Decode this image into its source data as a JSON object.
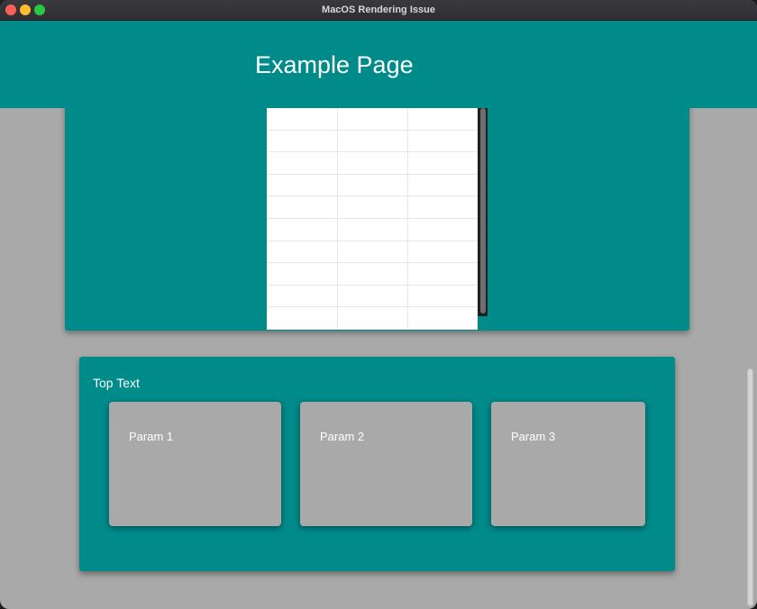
{
  "window": {
    "title": "MacOS Rendering Issue"
  },
  "header": {
    "title": "Example Page"
  },
  "table": {
    "rows": [
      [
        "",
        "",
        ""
      ],
      [
        "",
        "",
        ""
      ],
      [
        "",
        "",
        ""
      ],
      [
        "",
        "",
        ""
      ],
      [
        "",
        "",
        ""
      ],
      [
        "",
        "",
        ""
      ],
      [
        "",
        "",
        ""
      ],
      [
        "",
        "",
        ""
      ],
      [
        "",
        "",
        ""
      ],
      [
        "",
        "",
        ""
      ]
    ]
  },
  "section": {
    "label": "Top Text",
    "params": [
      "Param 1",
      "Param 2",
      "Param 3"
    ]
  },
  "colors": {
    "teal": "#008b8b",
    "background": "#a9a9a9"
  }
}
